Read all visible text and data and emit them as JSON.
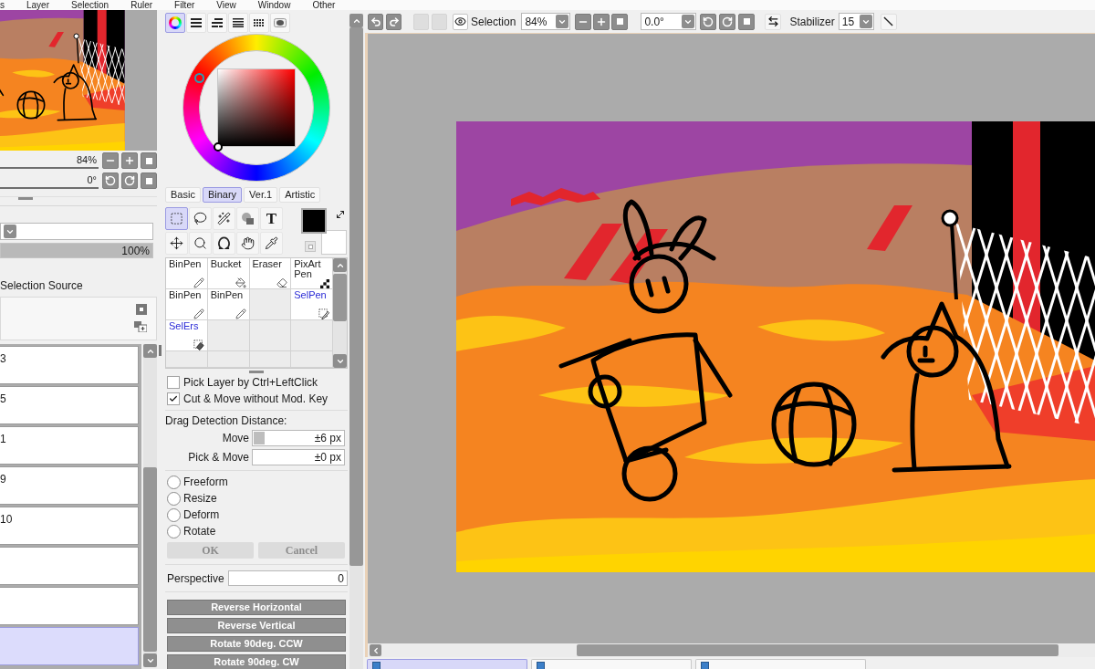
{
  "menu_bar": [
    "s",
    "Layer",
    "Selection",
    "Ruler",
    "Filter",
    "View",
    "Window",
    "Other"
  ],
  "navigator": {
    "zoom": "84%",
    "rotation": "0°"
  },
  "layer_panel": {
    "opacity": {
      "reading": "100%",
      "level": 1
    },
    "selection_source": "Selection Source",
    "layers": [
      {
        "name": "3",
        "selected": false
      },
      {
        "name": "5",
        "selected": false
      },
      {
        "name": "1",
        "selected": false
      },
      {
        "name": "9",
        "selected": false
      },
      {
        "name": "10",
        "selected": false
      },
      {
        "selected": false
      },
      {
        "selected": false
      },
      {
        "selected": true
      }
    ]
  },
  "color_panel": {
    "tabs": [
      {
        "kind": "wheel",
        "selected": true
      },
      {
        "kind": "rgb",
        "selected": false
      },
      {
        "kind": "hsv",
        "selected": false
      },
      {
        "kind": "swatches",
        "selected": false
      },
      {
        "kind": "mixer",
        "selected": false
      },
      {
        "kind": "scratchpad",
        "selected": false
      }
    ]
  },
  "brush_tabs": [
    {
      "label": "Basic",
      "selected": false
    },
    {
      "label": "Binary",
      "selected": true
    },
    {
      "label": "Ver.1",
      "selected": false
    },
    {
      "label": "Artistic",
      "selected": false
    }
  ],
  "tools": [
    {
      "kind": "rect-select",
      "selected": true
    },
    {
      "kind": "lasso",
      "selected": false
    },
    {
      "kind": "magic-wand",
      "selected": false
    },
    {
      "kind": "shape",
      "selected": false
    },
    {
      "kind": "text",
      "glyph": "T",
      "selected": false
    },
    {
      "kind": "move",
      "selected": false
    },
    {
      "kind": "zoom",
      "selected": false
    },
    {
      "kind": "rotate",
      "selected": false
    },
    {
      "kind": "hand",
      "selected": false
    },
    {
      "kind": "eyedropper",
      "selected": false
    }
  ],
  "color_swatches": [
    {
      "kind": "foreground",
      "color": "#000000"
    },
    {
      "kind": "background",
      "color": "#ffffff"
    }
  ],
  "brush_slots": [
    {
      "kind": "pen",
      "name": "BinPen"
    },
    {
      "kind": "bucket",
      "name": "Bucket"
    },
    {
      "kind": "eraser",
      "name": "Eraser"
    },
    {
      "kind": "pixel",
      "name": "PixArt Pen"
    },
    {
      "kind": "pen",
      "name": "BinPen"
    },
    {
      "kind": "pen",
      "name": "BinPen"
    },
    {
      "kind": "empty"
    },
    {
      "kind": "select-pen",
      "name": "SelPen"
    },
    {
      "kind": "select-eraser",
      "name": "SelErs"
    },
    {
      "kind": "empty"
    },
    {
      "kind": "empty"
    },
    {
      "kind": "empty"
    },
    {
      "kind": "empty"
    },
    {
      "kind": "empty"
    },
    {
      "kind": "empty"
    },
    {
      "kind": "empty"
    }
  ],
  "tool_options": {
    "checkboxes": [
      {
        "label": "Pick Layer by Ctrl+LeftClick",
        "checked": false
      },
      {
        "label": "Cut & Move without Mod. Key",
        "checked": true
      }
    ],
    "drag_detection": {
      "title": "Drag Detection Distance:",
      "fields": [
        {
          "label": "Move",
          "value": "±6 px",
          "level": 0.12
        },
        {
          "label": "Pick & Move",
          "value": "±0 px"
        }
      ]
    },
    "transform_modes": [
      {
        "label": "Freeform",
        "selected": false
      },
      {
        "label": "Resize",
        "selected": false
      },
      {
        "label": "Deform",
        "selected": false
      },
      {
        "label": "Rotate",
        "selected": false
      }
    ],
    "buttons": [
      {
        "label": "OK",
        "disabled": true
      },
      {
        "label": "Cancel",
        "disabled": true
      }
    ],
    "perspective": {
      "label": "Perspective",
      "value": "0"
    },
    "actions": [
      "Reverse Horizontal",
      "Reverse Vertical",
      "Rotate 90deg. CCW",
      "Rotate 90deg. CW"
    ]
  },
  "canvas_toolbar": {
    "history": [
      {
        "kind": "undo",
        "disabled": false
      },
      {
        "kind": "redo",
        "disabled": false
      },
      {
        "kind": "blank",
        "disabled": true
      },
      {
        "kind": "blank",
        "disabled": true
      }
    ],
    "view_label": "Selection",
    "zoom": "84%",
    "rotation": "0.0°",
    "stabilizer_label": "Stabilizer",
    "stabilizer": "15"
  },
  "document_tabs": [
    {
      "selected": true
    },
    {
      "selected": false
    },
    {
      "selected": false
    }
  ]
}
